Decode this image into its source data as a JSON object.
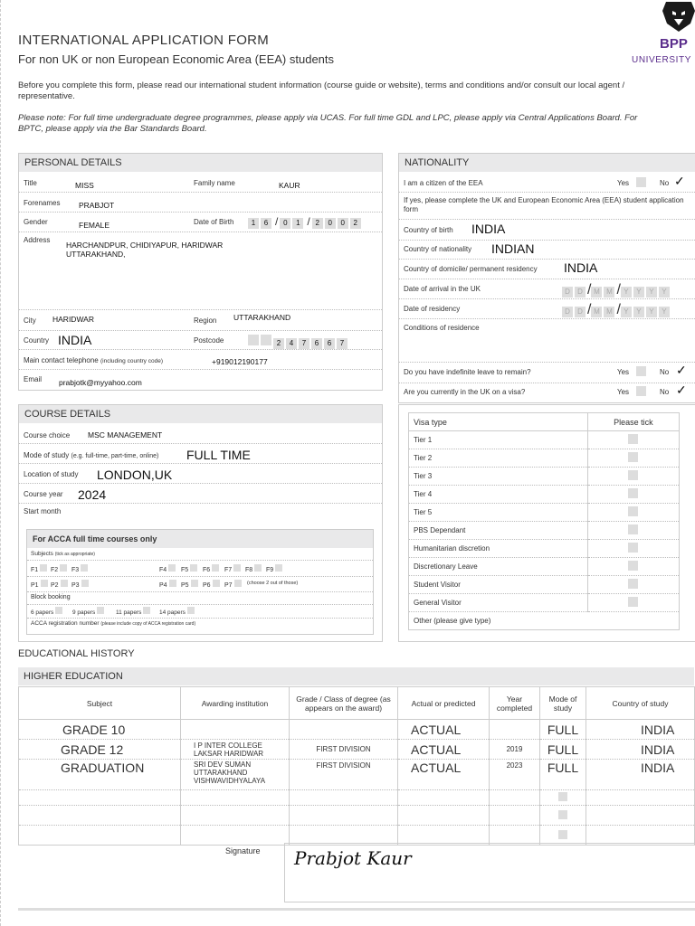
{
  "header": {
    "title": "INTERNATIONAL APPLICATION FORM",
    "subtitle": "For non UK or non European Economic Area (EEA) students",
    "intro": "Before you complete this form, please read our international student information (course guide or website), terms and conditions and/or consult our local agent / representative.",
    "note": "Please note: For full time undergraduate degree programmes, please apply via UCAS. For full time GDL and LPC, please apply via Central Applications Board. For BPTC, please apply via the Bar Standards Board.",
    "logo_text": "BPP",
    "logo_sub": "UNIVERSITY",
    "brand_color": "#5b2e8c"
  },
  "personal": {
    "heading": "PERSONAL DETAILS",
    "title_label": "Title",
    "title_value": "MISS",
    "family_label": "Family name",
    "family_value": "KAUR",
    "forenames_label": "Forenames",
    "forenames_value": "PRABJOT",
    "gender_label": "Gender",
    "gender_value": "FEMALE",
    "dob_label": "Date of Birth",
    "dob_d": [
      "1",
      "6"
    ],
    "dob_m": [
      "0",
      "1"
    ],
    "dob_y": [
      "2",
      "0",
      "0",
      "2"
    ],
    "address_label": "Address",
    "address_line1": "HARCHANDPUR, CHIDIYAPUR, HARIDWAR",
    "address_line2": "UTTARAKHAND,",
    "city_label": "City",
    "city_value": "HARIDWAR",
    "region_label": "Region",
    "region_value": "UTTARAKHAND",
    "country_label": "Country",
    "country_value": "INDIA",
    "postcode_label": "Postcode",
    "postcode_digits": [
      "",
      "",
      "2",
      "4",
      "7",
      "6",
      "6",
      "7"
    ],
    "phone_label": "Main contact telephone",
    "phone_hint": "(including country code)",
    "phone_value": "+919012190177",
    "email_label": "Email",
    "email_value": "prabjotk@myyahoo.com"
  },
  "nationality": {
    "heading": "NATIONALITY",
    "eea_label": "I am a citizen of the EEA",
    "yes": "Yes",
    "no": "No",
    "eea_instruction": "If yes, please complete the UK and European Economic Area (EEA) student application form",
    "birth_label": "Country of birth",
    "birth_value": "INDIA",
    "nat_label": "Country of nationality",
    "nat_value": "INDIAN",
    "domicile_label": "Country of domicile/ permanent residency",
    "domicile_value": "INDIA",
    "arrival_label": "Date of arrival in the UK",
    "residency_label": "Date of residency",
    "date_ph": [
      "D",
      "D",
      "M",
      "M",
      "Y",
      "Y",
      "Y",
      "Y"
    ],
    "conditions_label": "Conditions of residence",
    "indef_label": "Do you have indefinite leave to remain?",
    "visa_q_label": "Are you currently in the UK on a visa?",
    "tick": "✓"
  },
  "course": {
    "heading": "COURSE DETAILS",
    "choice_label": "Course choice",
    "choice_value": "MSC MANAGEMENT",
    "mode_label": "Mode of study",
    "mode_hint": "(e.g. full-time, part-time, online)",
    "mode_value": "FULL TIME",
    "location_label": "Location of study",
    "location_value": "LONDON,UK",
    "year_label": "Course year",
    "year_value": "2024",
    "start_label": "Start month",
    "acca_heading": "For ACCA full time courses only",
    "subjects_label": "Subjects",
    "subjects_hint": "(tick as appropriate)",
    "row1_left": [
      "F1",
      "F2",
      "F3"
    ],
    "row1_right": [
      "F4",
      "F5",
      "F6",
      "F7",
      "F8",
      "F9"
    ],
    "row2_left": [
      "P1",
      "P2",
      "P3"
    ],
    "row2_right": [
      "P4",
      "P5",
      "P6",
      "P7"
    ],
    "choose_note": "(choose 2 out of those)",
    "block_label": "Block booking",
    "block_options": [
      "6 papers",
      "9 papers",
      "11 papers",
      "14 papers"
    ],
    "acca_reg_label": "ACCA registration number",
    "acca_reg_hint": "(please include copy of ACCA registration card)"
  },
  "visa": {
    "col1": "Visa type",
    "col2": "Please tick",
    "types": [
      "Tier 1",
      "Tier 2",
      "Tier 3",
      "Tier 4",
      "Tier 5",
      "PBS Dependant",
      "Humanitarian discretion",
      "Discretionary Leave",
      "Student Visitor",
      "General Visitor",
      "Other (please give type)"
    ]
  },
  "education": {
    "heading": "EDUCATIONAL HISTORY",
    "sub_heading": "HIGHER EDUCATION",
    "columns": [
      "Subject",
      "Awarding institution",
      "Grade / Class of degree (as appears on the award)",
      "Actual or predicted",
      "Year completed",
      "Mode of study",
      "Country of study"
    ],
    "rows": [
      {
        "subject": "GRADE 10",
        "institution": "",
        "grade": "",
        "actual": "ACTUAL",
        "year": "",
        "mode": "FULL",
        "country": "INDIA"
      },
      {
        "subject": "GRADE 12",
        "institution": "I P INTER COLLEGE LAKSAR HARIDWAR",
        "grade": "FIRST DIVISION",
        "actual": "ACTUAL",
        "year": "2019",
        "mode": "FULL",
        "country": "INDIA"
      },
      {
        "subject": "GRADUATION",
        "institution": "SRI DEV SUMAN UTTARAKHAND VISHWAVIDHYALAYA",
        "grade": "FIRST DIVISION",
        "actual": "ACTUAL",
        "year": "2023",
        "mode": "FULL",
        "country": "INDIA"
      }
    ],
    "signature_label": "Signature",
    "signature_value": "Prabjot Kaur"
  }
}
